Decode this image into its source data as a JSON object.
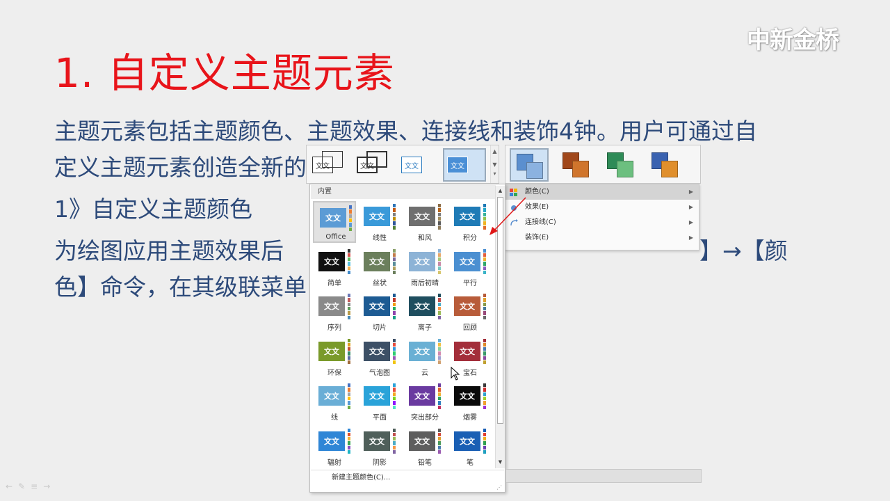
{
  "watermark": "中新金桥",
  "title": "1. 自定义主题元素",
  "body": {
    "line1": "主题元素包括主题颜色、主题效果、连接线和装饰4钟。用户可通过自",
    "line2": "定义主题元素创造全新的",
    "line3": "1》自定义主题颜色",
    "line4a": "为绘图应用主题效果后",
    "line4b": "】→【颜",
    "line5": "色】命令，在其级联菜单"
  },
  "layout_thumbs": [
    {
      "text": "文文"
    },
    {
      "text": "文文"
    },
    {
      "text": "文文"
    },
    {
      "text": "文文"
    }
  ],
  "style_thumbs": [
    {
      "back": "#5b8fcf",
      "front": "#8bb2e0"
    },
    {
      "back": "#a0471a",
      "front": "#d0752c"
    },
    {
      "back": "#2e8b57",
      "front": "#6cbf7f"
    },
    {
      "back": "#3a62b0",
      "front": "#e08f2c"
    }
  ],
  "menu": {
    "items": [
      {
        "label": "颜色(C)",
        "active": true
      },
      {
        "label": "效果(E)",
        "active": false
      },
      {
        "label": "连接线(C)",
        "active": false
      },
      {
        "label": "装饰(E)",
        "active": false
      }
    ]
  },
  "panel": {
    "header": "内置",
    "footer": "新建主题颜色(C)...",
    "swatch_text": "文文",
    "themes": [
      {
        "label": "Office",
        "color": "#5b9bd5",
        "palette": [
          "#4472c4",
          "#ed7d31",
          "#a5a5a5",
          "#ffc000",
          "#5b9bd5",
          "#70ad47"
        ]
      },
      {
        "label": "线性",
        "color": "#3a9ad9",
        "palette": [
          "#2e75b6",
          "#c55a11",
          "#7f7f7f",
          "#bf9000",
          "#2f5597",
          "#548235"
        ]
      },
      {
        "label": "和风",
        "color": "#6f6f6f",
        "palette": [
          "#8c6d46",
          "#b5651d",
          "#7a7a7a",
          "#a08b5b",
          "#5a5a5a",
          "#8e7b5a"
        ]
      },
      {
        "label": "积分",
        "color": "#1f7bb6",
        "palette": [
          "#1f7bb6",
          "#27a9c9",
          "#3ab39a",
          "#93c34f",
          "#f0b323",
          "#e26b2b"
        ]
      },
      {
        "label": "简单",
        "color": "#111111",
        "palette": [
          "#333333",
          "#d9534f",
          "#5cb85c",
          "#5bc0de",
          "#f0ad4e",
          "#428bca"
        ]
      },
      {
        "label": "丝状",
        "color": "#6b7f5c",
        "palette": [
          "#8aa06a",
          "#c27c4a",
          "#7f6b9a",
          "#5a8d9a",
          "#b0a060",
          "#6b7f5c"
        ]
      },
      {
        "label": "雨后初晴",
        "color": "#8db3d6",
        "palette": [
          "#8db3d6",
          "#e7a86a",
          "#a8c77a",
          "#c78aa8",
          "#7ac7c0",
          "#d6c66e"
        ]
      },
      {
        "label": "平行",
        "color": "#4b8fd1",
        "palette": [
          "#4b8fd1",
          "#e45f3c",
          "#f2b134",
          "#2fa86b",
          "#8b5fbf",
          "#3cb4c8"
        ]
      },
      {
        "label": "序列",
        "color": "#8a8a8a",
        "palette": [
          "#6c7ab8",
          "#c25b5b",
          "#8a8a8a",
          "#5b9b5b",
          "#b89b4a",
          "#4a8ab8"
        ]
      },
      {
        "label": "切片",
        "color": "#1d5b93",
        "palette": [
          "#1d5b93",
          "#c0392b",
          "#f39c12",
          "#27ae60",
          "#8e44ad",
          "#16a085"
        ]
      },
      {
        "label": "离子",
        "color": "#1f4e5f",
        "palette": [
          "#1f4e5f",
          "#c0504d",
          "#4bacc6",
          "#f79646",
          "#9bbb59",
          "#8064a2"
        ]
      },
      {
        "label": "回顾",
        "color": "#b85c3a",
        "palette": [
          "#b85c3a",
          "#e0a030",
          "#8a9a4a",
          "#4a7a9a",
          "#9a4a7a",
          "#6a6a6a"
        ]
      },
      {
        "label": "环保",
        "color": "#7a9a2a",
        "palette": [
          "#7a9a2a",
          "#e0a020",
          "#c05030",
          "#3a8a6a",
          "#5a6aa0",
          "#a06a3a"
        ]
      },
      {
        "label": "气泡图",
        "color": "#3d5066",
        "palette": [
          "#3d5066",
          "#e74c3c",
          "#3498db",
          "#2ecc71",
          "#9b59b6",
          "#f1c40f"
        ]
      },
      {
        "label": "云",
        "color": "#6ab0d4",
        "palette": [
          "#6ab0d4",
          "#f0c040",
          "#8ad0a0",
          "#d08ab0",
          "#a0a0d0",
          "#d0a070"
        ]
      },
      {
        "label": "宝石",
        "color": "#a32e3a",
        "palette": [
          "#a32e3a",
          "#e08a2a",
          "#4a7ab0",
          "#3a9a6a",
          "#8a4aa0",
          "#c0a030"
        ]
      },
      {
        "label": "线",
        "color": "#6aaed6",
        "palette": [
          "#4472c4",
          "#ed7d31",
          "#a5a5a5",
          "#ffc000",
          "#5b9bd5",
          "#70ad47"
        ]
      },
      {
        "label": "平面",
        "color": "#2aa3d9",
        "palette": [
          "#2aa3d9",
          "#e94e3c",
          "#f5a623",
          "#7ed321",
          "#9013fe",
          "#50e3c2"
        ]
      },
      {
        "label": "突出部分",
        "color": "#6a3aa0",
        "palette": [
          "#6a3aa0",
          "#e06030",
          "#f0b030",
          "#30a060",
          "#3080c0",
          "#c03060"
        ]
      },
      {
        "label": "烟雾",
        "color": "#0a0a0a",
        "palette": [
          "#3a3a3a",
          "#d03030",
          "#30a0d0",
          "#a0d030",
          "#f0a030",
          "#a030d0"
        ]
      },
      {
        "label": "辐射",
        "color": "#2f86d6",
        "palette": [
          "#2f86d6",
          "#e0512a",
          "#f2b233",
          "#3aa655",
          "#8c4fc1",
          "#1fb4c4"
        ]
      },
      {
        "label": "阴影",
        "color": "#4f5f5a",
        "palette": [
          "#4f5f5a",
          "#c0504d",
          "#9bbb59",
          "#4bacc6",
          "#f79646",
          "#8064a2"
        ]
      },
      {
        "label": "铅笔",
        "color": "#5e5e5e",
        "palette": [
          "#5e5e5e",
          "#d04a3a",
          "#e0a030",
          "#4a9a5a",
          "#4a7ab0",
          "#9a5ab0"
        ]
      },
      {
        "label": "笔",
        "color": "#1a5fb4",
        "palette": [
          "#1a5fb4",
          "#e04030",
          "#f0b020",
          "#30a050",
          "#7040b0",
          "#20a0c0"
        ]
      }
    ]
  }
}
